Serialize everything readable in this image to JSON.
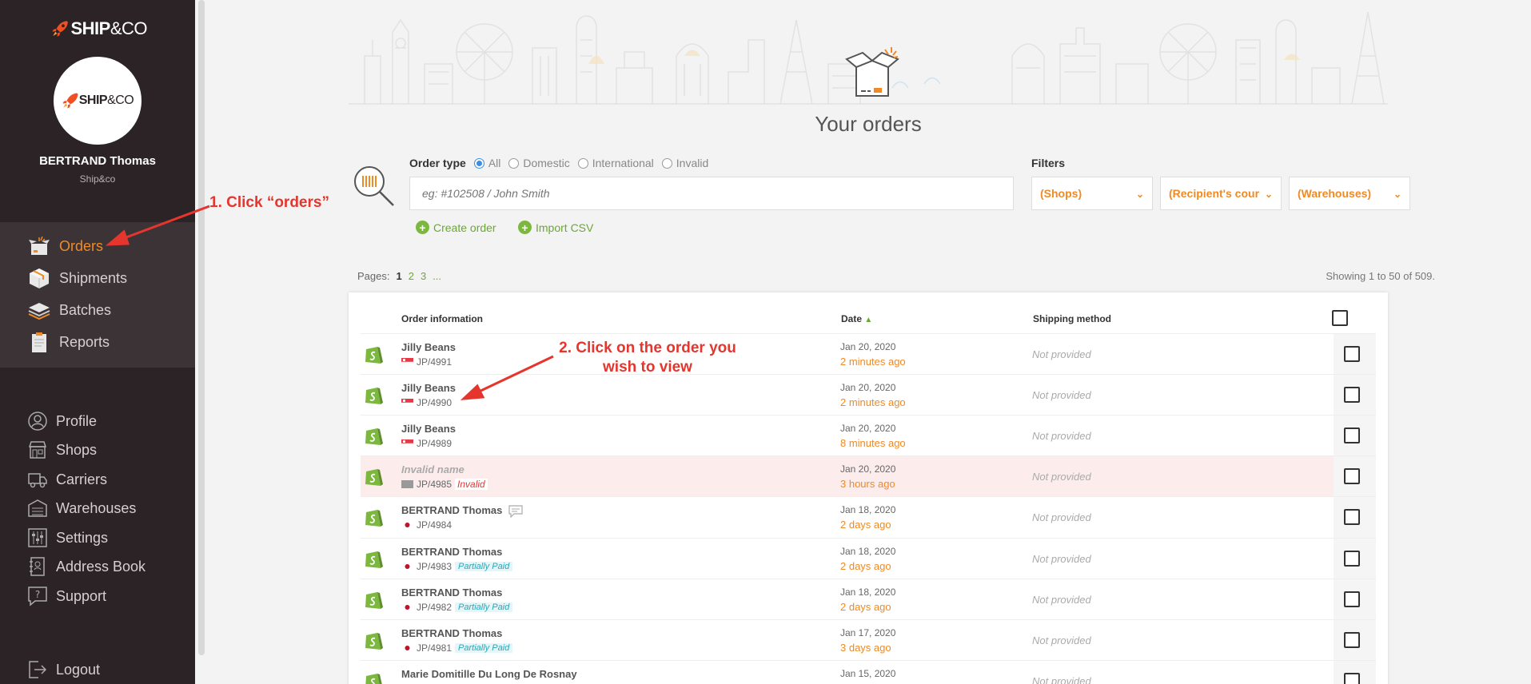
{
  "brand": {
    "logo_ship": "SHIP",
    "logo_co": "&CO",
    "accent": "#f08a24"
  },
  "user": {
    "name": "BERTRAND Thomas",
    "company": "Ship&co"
  },
  "nav_main": [
    {
      "label": "Orders",
      "icon": "orders-icon",
      "active": true
    },
    {
      "label": "Shipments",
      "icon": "shipments-icon"
    },
    {
      "label": "Batches",
      "icon": "batches-icon"
    },
    {
      "label": "Reports",
      "icon": "reports-icon"
    }
  ],
  "nav_secondary": [
    {
      "label": "Profile",
      "icon": "profile-icon"
    },
    {
      "label": "Shops",
      "icon": "shops-icon"
    },
    {
      "label": "Carriers",
      "icon": "carriers-icon"
    },
    {
      "label": "Warehouses",
      "icon": "warehouses-icon"
    },
    {
      "label": "Settings",
      "icon": "settings-icon"
    },
    {
      "label": "Address Book",
      "icon": "address-book-icon"
    },
    {
      "label": "Support",
      "icon": "support-icon"
    }
  ],
  "logout": {
    "label": "Logout",
    "icon": "logout-icon"
  },
  "page_title": "Your orders",
  "order_type": {
    "label": "Order type",
    "options": [
      "All",
      "Domestic",
      "International",
      "Invalid"
    ],
    "selected": "All"
  },
  "search": {
    "placeholder": "eg: #102508 / John Smith"
  },
  "filters": {
    "label": "Filters",
    "shops": "(Shops)",
    "recipient": "(Recipient's cour",
    "warehouses": "(Warehouses)"
  },
  "actions": {
    "create_order": "Create order",
    "import_csv": "Import CSV"
  },
  "pagination": {
    "label": "Pages:",
    "current": "1",
    "pages": [
      "2",
      "3",
      "..."
    ],
    "showing": "Showing 1 to 50 of 509."
  },
  "table": {
    "headers": {
      "order_info": "Order information",
      "date": "Date",
      "shipping": "Shipping method"
    },
    "rows": [
      {
        "name": "Jilly Beans",
        "order": "JP/4991",
        "flag": "sg",
        "date": "Jan 20, 2020",
        "ago": "2 minutes ago",
        "shipping": "Not provided"
      },
      {
        "name": "Jilly Beans",
        "order": "JP/4990",
        "flag": "sg",
        "date": "Jan 20, 2020",
        "ago": "2 minutes ago",
        "shipping": "Not provided"
      },
      {
        "name": "Jilly Beans",
        "order": "JP/4989",
        "flag": "sg",
        "date": "Jan 20, 2020",
        "ago": "8 minutes ago",
        "shipping": "Not provided"
      },
      {
        "name": "Invalid name",
        "order": "JP/4985",
        "flag": "none",
        "tag": "Invalid",
        "tag_type": "invalid",
        "date": "Jan 20, 2020",
        "ago": "3 hours ago",
        "shipping": "Not provided"
      },
      {
        "name": "BERTRAND Thomas",
        "order": "JP/4984",
        "flag": "jp",
        "comment": true,
        "date": "Jan 18, 2020",
        "ago": "2 days ago",
        "shipping": "Not provided"
      },
      {
        "name": "BERTRAND Thomas",
        "order": "JP/4983",
        "flag": "jp",
        "tag": "Partially Paid",
        "tag_type": "paid",
        "date": "Jan 18, 2020",
        "ago": "2 days ago",
        "shipping": "Not provided"
      },
      {
        "name": "BERTRAND Thomas",
        "order": "JP/4982",
        "flag": "jp",
        "tag": "Partially Paid",
        "tag_type": "paid",
        "date": "Jan 18, 2020",
        "ago": "2 days ago",
        "shipping": "Not provided"
      },
      {
        "name": "BERTRAND Thomas",
        "order": "JP/4981",
        "flag": "jp",
        "tag": "Partially Paid",
        "tag_type": "paid",
        "date": "Jan 17, 2020",
        "ago": "3 days ago",
        "shipping": "Not provided"
      },
      {
        "name": "Marie Domitille Du Long De Rosnay",
        "order": "",
        "flag": "jp",
        "date": "Jan 15, 2020",
        "ago": "",
        "shipping": "Not provided"
      }
    ]
  },
  "annotations": {
    "step1": "1. Click “orders”",
    "step2_line1": "2. Click on the order you",
    "step2_line2": "wish to view",
    "color": "#e5352d"
  }
}
